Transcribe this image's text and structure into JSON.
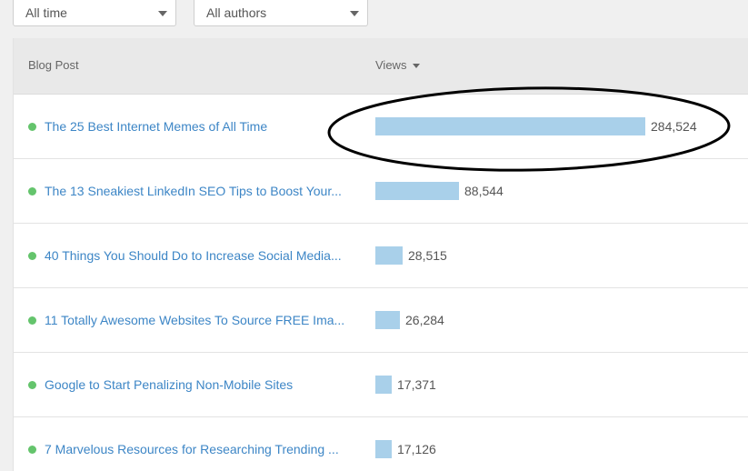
{
  "filters": {
    "time_range": "All time",
    "authors": "All authors"
  },
  "table": {
    "columns": {
      "post": "Blog Post",
      "views": "Views"
    },
    "max_views": 284524,
    "rows": [
      {
        "title": "The 25 Best Internet Memes of All Time",
        "views": 284524,
        "views_label": "284,524"
      },
      {
        "title": "The 13 Sneakiest LinkedIn SEO Tips to Boost Your...",
        "views": 88544,
        "views_label": "88,544"
      },
      {
        "title": "40 Things You Should Do to Increase Social Media...",
        "views": 28515,
        "views_label": "28,515"
      },
      {
        "title": "11 Totally Awesome Websites To Source FREE Ima...",
        "views": 26284,
        "views_label": "26,284"
      },
      {
        "title": "Google to Start Penalizing Non-Mobile Sites",
        "views": 17371,
        "views_label": "17,371"
      },
      {
        "title": "7 Marvelous Resources for Researching Trending ...",
        "views": 17126,
        "views_label": "17,126"
      }
    ]
  },
  "colors": {
    "bar": "#a9d0ea",
    "link": "#3d86c6",
    "status_dot": "#64c46c",
    "header_bg": "#e9e9e9",
    "annotation_ring": "#000000"
  },
  "icons": {
    "dropdown_caret": "chevron-down-icon",
    "sort": "sort-desc-icon"
  }
}
